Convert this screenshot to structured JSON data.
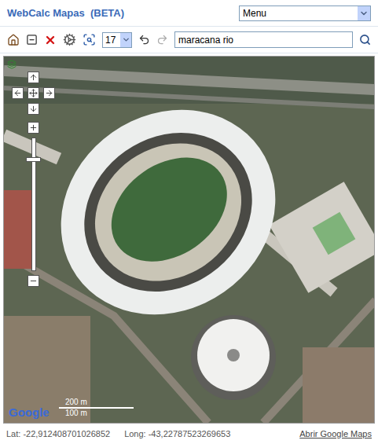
{
  "header": {
    "title": "WebCalc Mapas  (BETA)",
    "menu": {
      "value": "Menu"
    }
  },
  "toolbar": {
    "zoom": {
      "value": "17"
    },
    "search": {
      "value": "maracana rio"
    },
    "undo": {
      "disabled": false
    },
    "redo": {
      "disabled": true
    }
  },
  "map": {
    "zoom_slider": {
      "level": 0.85
    },
    "logo": "Google",
    "scale": [
      "200 m",
      "100 m"
    ]
  },
  "status_bar": {
    "lat": "Lat: -22,912408701026852",
    "long": "Long: -43,22787523269653",
    "link": "Abrir Google Maps"
  }
}
